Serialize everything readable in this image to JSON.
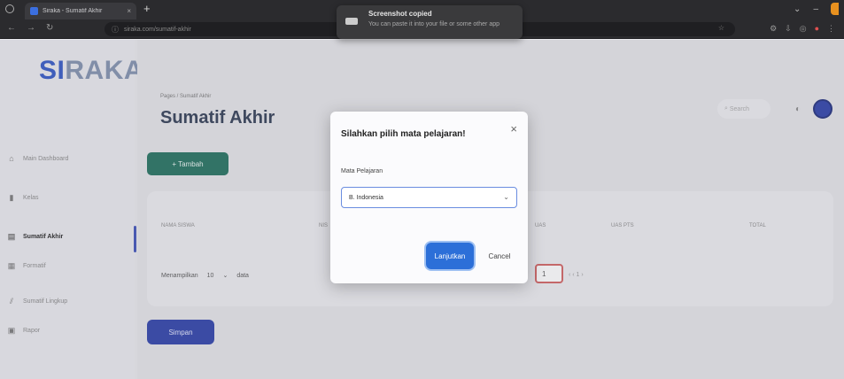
{
  "browser": {
    "tab_title": "Siraka - Sumatif Akhir",
    "new_tab": "+",
    "url": "siraka.com/sumatif-akhir",
    "toast_title": "Screenshot copied",
    "toast_message": "You can paste it into your file or some other app"
  },
  "app": {
    "logo_left": "SI",
    "logo_right": "RAKA",
    "sidebar": [
      {
        "label": "Main Dashboard",
        "icon": "home-icon"
      },
      {
        "label": "Kelas",
        "icon": "class-icon"
      },
      {
        "label": "Sumatif Akhir",
        "icon": "document-icon",
        "active": true
      },
      {
        "label": "Formatif",
        "icon": "form-icon"
      },
      {
        "label": "Sumatif Lingkup",
        "icon": "chart-icon"
      },
      {
        "label": "Rapor",
        "icon": "report-icon"
      }
    ],
    "breadcrumb": "Pages / Sumatif Akhir",
    "page_title": "Sumatif Akhir",
    "search_placeholder": "Search",
    "add_button": "+ Tambah",
    "columns": [
      "NAMA SISWA",
      "NIS",
      "UAS",
      "UAS PTS",
      "TOTAL"
    ],
    "show_label": "Menampilkan",
    "show_value": "10",
    "show_suffix": "data",
    "page_value": "1",
    "pager": "‹  ‹  1  ›",
    "save_button": "Simpan"
  },
  "modal": {
    "title": "Silahkan pilih mata pelajaran!",
    "close": "×",
    "field_label": "Mata Pelajaran",
    "select_value": "B. Indonesia",
    "continue_button": "Lanjutkan",
    "cancel_button": "Cancel"
  }
}
